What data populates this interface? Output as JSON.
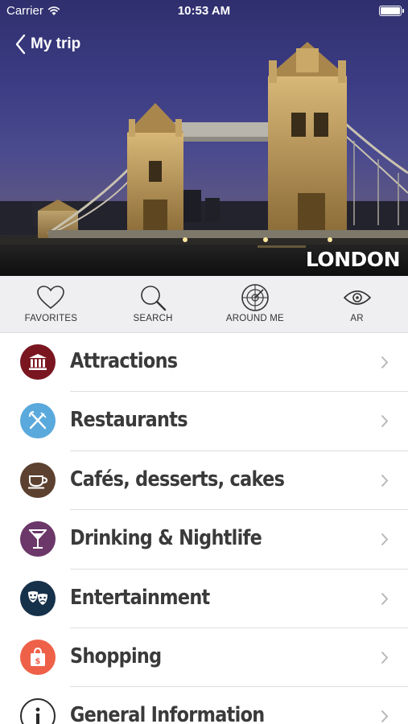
{
  "status_bar": {
    "carrier": "Carrier",
    "time": "10:53 AM"
  },
  "nav": {
    "back_label": "My trip"
  },
  "hero": {
    "city": "LONDON"
  },
  "toolbar": {
    "items": [
      {
        "label": "FAVORITES",
        "icon": "heart-icon"
      },
      {
        "label": "SEARCH",
        "icon": "magnifier-icon"
      },
      {
        "label": "AROUND ME",
        "icon": "radar-icon"
      },
      {
        "label": "AR",
        "icon": "eye-icon"
      }
    ]
  },
  "categories": [
    {
      "label": "Attractions",
      "icon": "museum-icon",
      "color": "#7a1620"
    },
    {
      "label": "Restaurants",
      "icon": "fork-knife-icon",
      "color": "#5aa9dc"
    },
    {
      "label": "Cafés, desserts, cakes",
      "icon": "coffee-cup-icon",
      "color": "#5c4130"
    },
    {
      "label": "Drinking & Nightlife",
      "icon": "cocktail-icon",
      "color": "#6c3769"
    },
    {
      "label": "Entertainment",
      "icon": "theater-masks-icon",
      "color": "#16314a"
    },
    {
      "label": "Shopping",
      "icon": "shopping-bag-icon",
      "color": "#ee6148"
    },
    {
      "label": "General Information",
      "icon": "info-icon",
      "color": "#ffffff"
    }
  ]
}
